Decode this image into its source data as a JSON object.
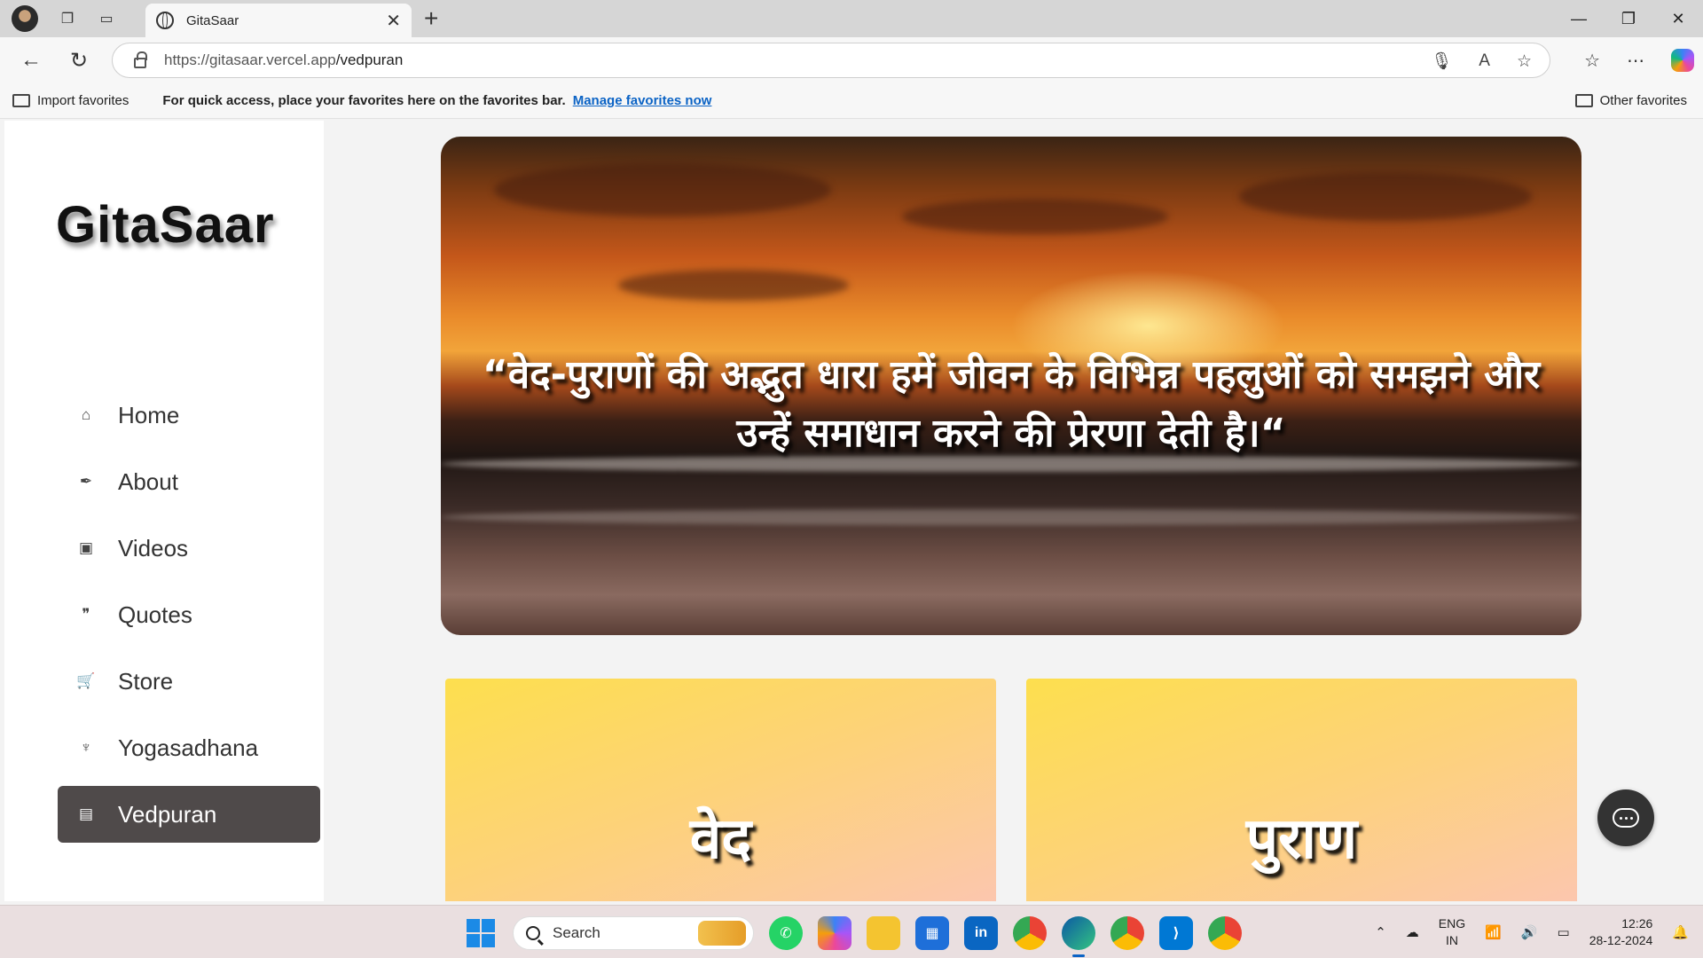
{
  "browser": {
    "tab_title": "GitaSaar",
    "url_host": "https://gitasaar.vercel.app",
    "url_path": "/vedpuran",
    "favorites_import": "Import favorites",
    "favorites_message": "For quick access, place your favorites here on the favorites bar.",
    "favorites_link": "Manage favorites now",
    "other_favorites": "Other favorites"
  },
  "sidebar": {
    "brand": "GitaSaar",
    "items": [
      {
        "label": "Home",
        "icon": "home-icon",
        "glyph": "⌂"
      },
      {
        "label": "About",
        "icon": "feather-icon",
        "glyph": "✒"
      },
      {
        "label": "Videos",
        "icon": "video-icon",
        "glyph": "▣"
      },
      {
        "label": "Quotes",
        "icon": "quote-icon",
        "glyph": "❞"
      },
      {
        "label": "Store",
        "icon": "cart-icon",
        "glyph": "🛒"
      },
      {
        "label": "Yogasadhana",
        "icon": "yoga-icon",
        "glyph": "♆"
      },
      {
        "label": "Vedpuran",
        "icon": "book-icon",
        "glyph": "▤",
        "active": true
      }
    ]
  },
  "hero": {
    "quote": "“वेद-पुराणों की अद्भुत धारा हमें जीवन के विभिन्न पहलुओं को समझने और उन्हें समाधान करने की प्रेरणा देती है।“"
  },
  "cards": [
    {
      "label": "वेद"
    },
    {
      "label": "पुराण"
    }
  ],
  "taskbar": {
    "search_placeholder": "Search",
    "language_line1": "ENG",
    "language_line2": "IN",
    "time": "12:26",
    "date": "28-12-2024"
  },
  "colors": {
    "active_nav": "#4f4a4a",
    "card_gradient_start": "#fddf4e",
    "card_gradient_end": "#fcc6b0",
    "link": "#0b63c5"
  }
}
